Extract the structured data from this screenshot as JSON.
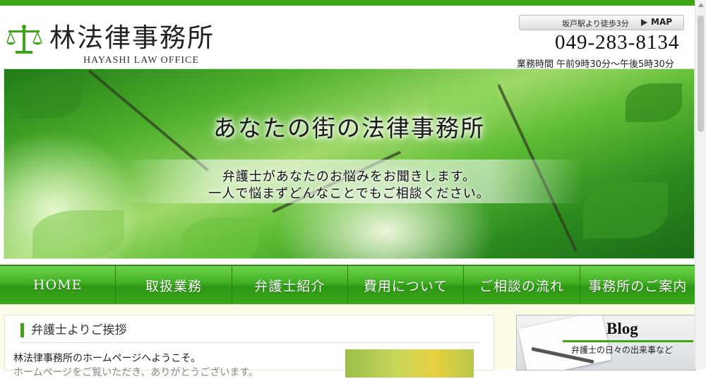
{
  "header": {
    "title": "林法律事務所",
    "subtitle": "HAYASHI LAW OFFICE",
    "access_text": "坂戸駅より徒歩3分",
    "map_label": "MAP",
    "phone": "049-283-8134",
    "hours": "業務時間 午前9時30分～午後5時30分"
  },
  "hero": {
    "title": "あなたの街の法律事務所",
    "line1": "弁護士があなたのお悩みをお聞きします。",
    "line2": "一人で悩まずどんなことでもご相談ください。"
  },
  "nav": {
    "items": [
      {
        "label": "HOME"
      },
      {
        "label": "取扱業務"
      },
      {
        "label": "弁護士紹介"
      },
      {
        "label": "費用について"
      },
      {
        "label": "ご相談の流れ"
      },
      {
        "label": "事務所のご案内"
      }
    ]
  },
  "main": {
    "section_title": "弁護士よりご挨拶",
    "greeting": "林法律事務所のホームページへようこそ。",
    "greeting_cont": "ホームページをご覧いただき、ありがとうございます。"
  },
  "blog": {
    "title": "Blog",
    "subtitle": "弁護士の日々の出来事など"
  },
  "colors": {
    "accent": "#3ea41a",
    "nav_green": "#3fae22"
  }
}
